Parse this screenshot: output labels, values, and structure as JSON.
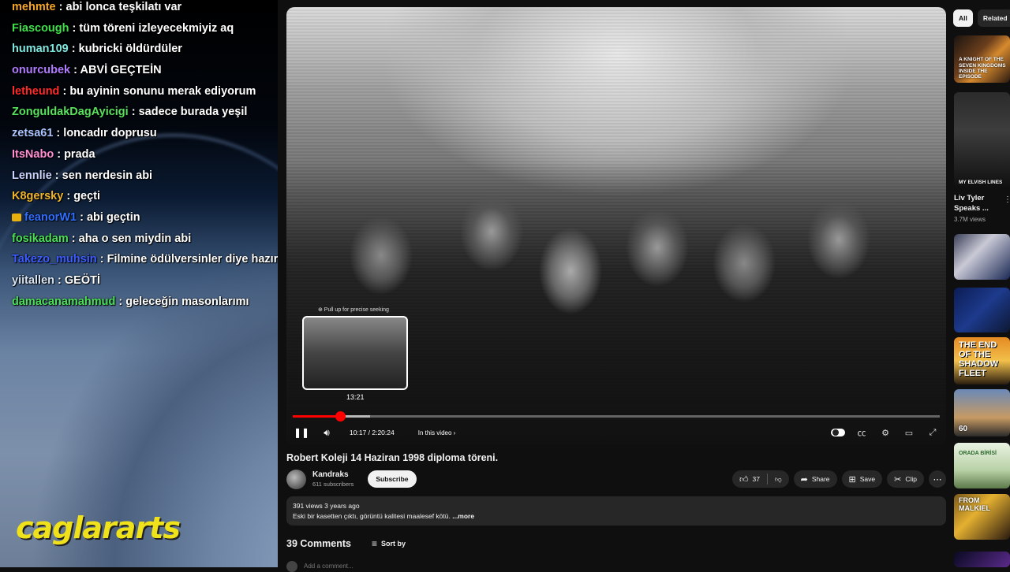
{
  "chat": {
    "lines": [
      {
        "user": "mehmte",
        "message": "abi lonca teşkilatı var",
        "color": "#f6a623"
      },
      {
        "user": "Fiascough",
        "message": "tüm töreni izleyecekmiyiz aq",
        "color": "#3fe04a"
      },
      {
        "user": "human109",
        "message": "kubricki öldürdüler",
        "color": "#7fe7e0"
      },
      {
        "user": "onurcubek",
        "message": "ABVİ GEÇTEİN",
        "color": "#b07bff"
      },
      {
        "user": "letheund",
        "message": "bu ayinin sonunu merak ediyorum",
        "color": "#ff2b2b"
      },
      {
        "user": "ZonguldakDagAyicigi",
        "message": "sadece burada yeşil",
        "color": "#57e35c"
      },
      {
        "user": "zetsa61",
        "message": "loncadır doprusu",
        "color": "#a9c4ff"
      },
      {
        "user": "ItsNabo",
        "message": "prada",
        "color": "#ff8fd0"
      },
      {
        "user": "Lennlie",
        "message": "sen nerdesin abi",
        "color": "#c9d4ff"
      },
      {
        "user": "K8gersky",
        "message": "geçti",
        "color": "#f0b52a"
      },
      {
        "user": "feanorW1",
        "message": "abi geçtin",
        "color": "#2f6fff"
      },
      {
        "user": "fosikadam",
        "message": "aha o sen miydin abi",
        "color": "#4be058"
      },
      {
        "user": "Takezo_muhsin",
        "message": "Filmine ödülversinler diye hazırlık yapmış",
        "color": "#3b5cff"
      },
      {
        "user": "yiitallen",
        "message": "GEÖTİ",
        "color": "#d9e4f2"
      },
      {
        "user": "damacanamahmud",
        "message": "geleceğin masonlarımı",
        "color": "#4be058"
      }
    ],
    "watermark": "caglararts"
  },
  "player": {
    "seek_hint": "⊕ Pull up for precise seeking",
    "seek_preview_time": "13:21",
    "time_label": "10:17 / 2:20:24",
    "chapter_label": "In this video",
    "progress": 0.073,
    "buffered": 0.12,
    "accent_color": "#ff0000"
  },
  "video": {
    "title": "Robert Koleji 14 Haziran 1998 diploma töreni.",
    "channel_name": "Kandraks",
    "subscribers": "611 subscribers",
    "subscribe_label": "Subscribe",
    "likes": "37",
    "share_label": "Share",
    "save_label": "Save",
    "clip_label": "Clip",
    "stats": "391 views  3 years ago",
    "description": "Eski bir kasetten çıktı, görüntü kalitesi maalesef kötü.",
    "more_label": "...more",
    "comments_count": "39 Comments",
    "sort_label": "Sort by",
    "add_comment": "Add a comment..."
  },
  "sidebar": {
    "chips": [
      {
        "label": "All",
        "active": true
      },
      {
        "label": "Related",
        "active": false
      }
    ],
    "thumb_texts": {
      "t1": "A KNIGHT OF THE SEVEN KINGDOMS\nINSIDE THE EPISODE",
      "t2": "MY ELVISH LINES",
      "t5": "THE END OF THE SHADOW FLEET",
      "t6": "60",
      "t7": "ORADA BİRİSİ",
      "t8": "FROM MALKIEL"
    },
    "featured_title_line1": "Liv Tyler",
    "featured_title_line2": "Speaks ...",
    "featured_views": "3.7M views"
  }
}
